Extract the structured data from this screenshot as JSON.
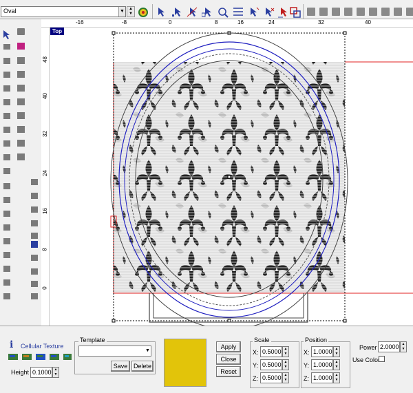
{
  "toolbar": {
    "object_select": "Oval",
    "colors": {
      "icon_blue": "#2b3fa0",
      "icon_red": "#c02020",
      "icon_gray": "#8a8a8a"
    }
  },
  "viewport": {
    "view_label": "Top",
    "ruler_top_ticks": [
      "-16",
      "-8",
      "0",
      "8",
      "16",
      "24",
      "32",
      "40"
    ],
    "ruler_left_ticks": [
      "48",
      "40",
      "32",
      "24",
      "16",
      "8",
      "0"
    ],
    "colors": {
      "blue_curve": "#2020c0",
      "red_guide": "#e02020",
      "pattern": "#222222"
    }
  },
  "texture_panel": {
    "info_icon": "i",
    "title": "Cellular Texture",
    "height_label": "Height",
    "height_value": "0.1000",
    "template_label": "Template",
    "template_value": "",
    "save_label": "Save",
    "delete_label": "Delete",
    "swatch_color": "#e2c40a",
    "apply_label": "Apply",
    "close_label": "Close",
    "reset_label": "Reset",
    "scale": {
      "label": "Scale",
      "x_label": "X:",
      "x": "0.5000",
      "y_label": "Y:",
      "y": "0.5000",
      "z_label": "Z:",
      "z": "0.5000"
    },
    "position": {
      "label": "Position",
      "x_label": "X:",
      "x": "1.0000",
      "y_label": "Y:",
      "y": "1.0000",
      "z_label": "Z:",
      "z": "1.0000"
    },
    "power_label": "Power",
    "power_value": "2.0000",
    "use_color_label": "Use Color"
  }
}
